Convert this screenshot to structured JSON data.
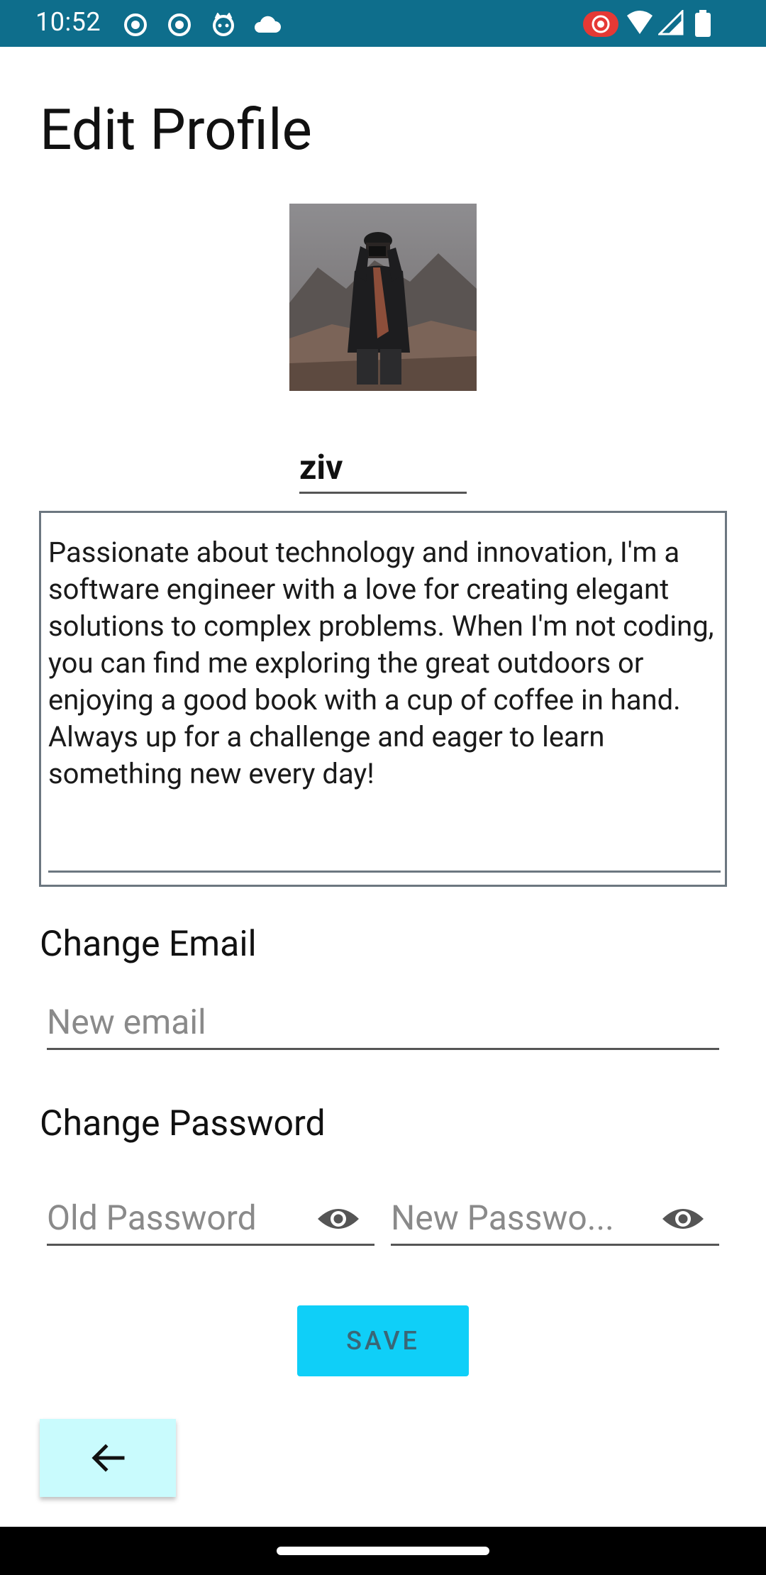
{
  "status_bar": {
    "time": "10:52",
    "icons_left": [
      "record-icon",
      "record-icon",
      "cat-icon",
      "cloud-icon"
    ],
    "icons_right": [
      "cast-icon",
      "wifi-icon",
      "signal-icon",
      "battery-icon"
    ]
  },
  "page": {
    "title": "Edit Profile"
  },
  "profile": {
    "username": "ziv",
    "bio": "Passionate about technology and innovation, I'm a software engineer with a love for creating elegant solutions to complex problems. When I'm not coding, you can find me exploring the great outdoors or enjoying a good book with a cup of coffee in hand. Always up for a challenge and eager to learn something new every day!"
  },
  "email_section": {
    "label": "Change Email",
    "new_email_placeholder": "New email"
  },
  "password_section": {
    "label": "Change Password",
    "old_password_placeholder": "Old Password",
    "new_password_placeholder": "New Passwo..."
  },
  "actions": {
    "save_label": "SAVE",
    "back_icon": "arrow-back-icon"
  },
  "colors": {
    "status_bar": "#0e6e8c",
    "save_button": "#0fcff8",
    "back_button": "#c9fbfd"
  }
}
